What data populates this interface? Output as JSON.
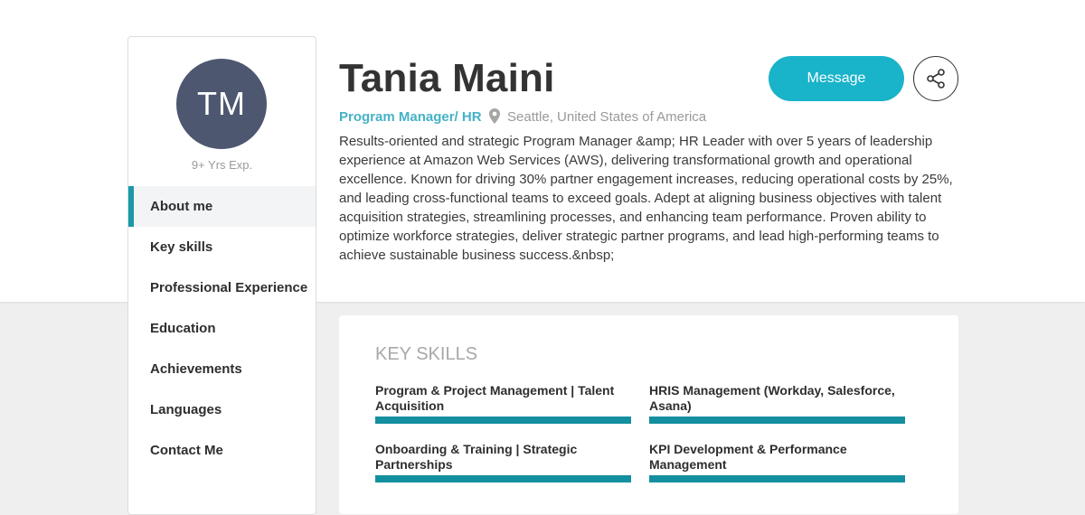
{
  "profile": {
    "initials": "TM",
    "experience": "9+ Yrs Exp.",
    "name": "Tania Maini",
    "role": "Program Manager/ HR",
    "location": "Seattle, United States of America",
    "bio": "Results-oriented and strategic Program Manager &amp; HR Leader with over 5 years of leadership experience at Amazon Web Services (AWS), delivering transformational growth and operational excellence. Known for driving 30% partner engagement increases, reducing operational costs by 25%, and leading cross-functional teams to exceed goals. Adept at aligning business objectives with talent acquisition strategies, streamlining processes, and enhancing team performance. Proven ability to optimize workforce strategies, deliver strategic partner programs, and lead high-performing teams to achieve sustainable business success.&nbsp;"
  },
  "actions": {
    "message_label": "Message",
    "share_icon": "share-icon"
  },
  "nav": {
    "items": [
      {
        "label": "About me",
        "active": true
      },
      {
        "label": "Key skills"
      },
      {
        "label": "Professional Experience"
      },
      {
        "label": "Education"
      },
      {
        "label": "Achievements"
      },
      {
        "label": "Languages"
      },
      {
        "label": "Contact Me"
      }
    ]
  },
  "skills": {
    "title": "KEY SKILLS",
    "items": [
      {
        "name": "Program & Project Management | Talent Acquisition",
        "level": 1.0
      },
      {
        "name": "HRIS Management (Workday, Salesforce, Asana)",
        "level": 1.0
      },
      {
        "name": "Onboarding & Training | Strategic Partnerships",
        "level": 1.0
      },
      {
        "name": "KPI Development & Performance Management",
        "level": 1.0
      }
    ]
  },
  "colors": {
    "accent": "#19b3ca",
    "role_text": "#45b2c6",
    "avatar_bg": "#4e5770",
    "skill_bar": "#148f9f"
  }
}
